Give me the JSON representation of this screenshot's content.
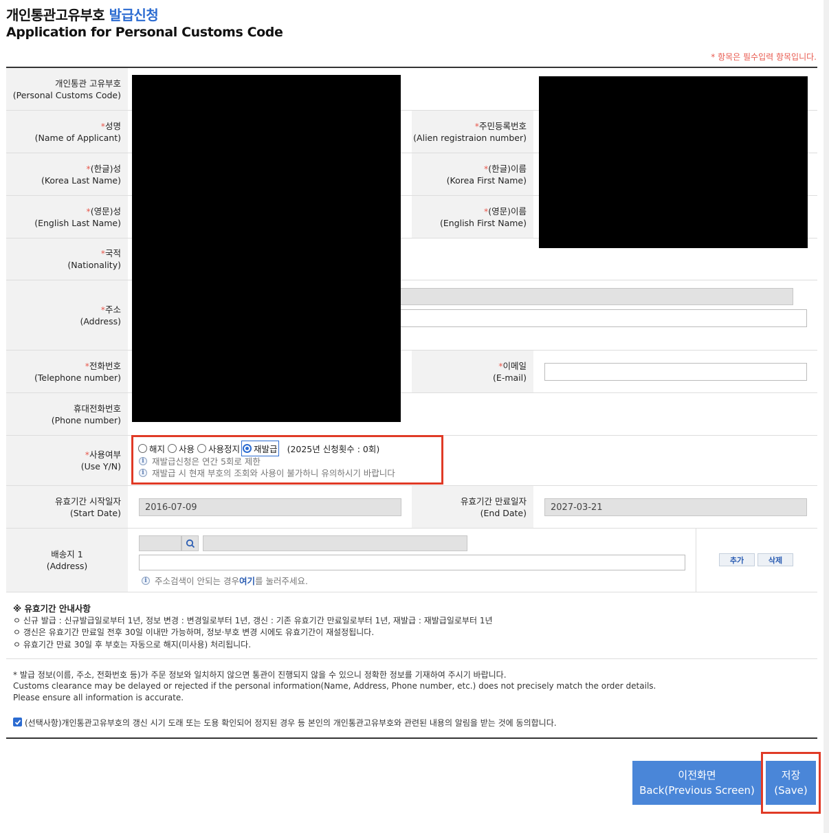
{
  "header": {
    "title_ko_main": "개인통관고유부호",
    "title_ko_accent": "발급신청",
    "title_en": "Application for Personal Customs Code",
    "required_note": "* 항목은 필수입력 항목입니다."
  },
  "form": {
    "customs_code": {
      "label_ko": "개인통관 고유부호",
      "label_en": "(Personal Customs Code)"
    },
    "applicant_name": {
      "label_ko": "성명",
      "label_en": "(Name of Applicant)"
    },
    "alien_reg": {
      "label_ko": "주민등록번호",
      "label_en": "(Alien registraion number)"
    },
    "ko_last": {
      "label_ko": "(한글)성",
      "label_en": "(Korea Last Name)"
    },
    "ko_first": {
      "label_ko": "(한글)이름",
      "label_en": "(Korea First Name)"
    },
    "en_last": {
      "label_ko": "(영문)성",
      "label_en": "(English Last Name)"
    },
    "en_first": {
      "label_ko": "(영문)이름",
      "label_en": "(English First Name)"
    },
    "nationality": {
      "label_ko": "국적",
      "label_en": "(Nationality)"
    },
    "address": {
      "label_ko": "주소",
      "label_en": "(Address)"
    },
    "telephone": {
      "label_ko": "전화번호",
      "label_en": "(Telephone number)"
    },
    "email": {
      "label_ko": "이메일",
      "label_en": "(E-mail)",
      "value": ""
    },
    "phone": {
      "label_ko": "휴대전화번호",
      "label_en": "(Phone number)"
    },
    "use_yn": {
      "label_ko": "사용여부",
      "label_en": "(Use Y/N)",
      "options": [
        "해지",
        "사용",
        "사용정지",
        "재발급"
      ],
      "selected": "재발급",
      "count_text": "(2025년 신청횟수 : 0회)",
      "info1": "재발급신청은 연간 5회로 제한",
      "info2": "재발급 시 현재 부호의 조회와 사용이 불가하니 유의하시기 바랍니다"
    },
    "start_date": {
      "label_ko": "유효기간 시작일자",
      "label_en": "(Start Date)",
      "value": "2016-07-09"
    },
    "end_date": {
      "label_ko": "유효기간 만료일자",
      "label_en": "(End Date)",
      "value": "2027-03-21"
    },
    "delivery": {
      "label_ko": "배송지 1",
      "label_en": "(Address)",
      "hint_prefix": "주소검색이 안되는 경우 ",
      "hint_link": "여기",
      "hint_suffix": "를 눌러주세요.",
      "add_label": "추가",
      "delete_label": "삭제"
    }
  },
  "notes": {
    "title": "※ 유효기간 안내사항",
    "lines": [
      "ㅇ 신규 발급 : 신규발급일로부터 1년, 정보 변경 : 변경일로부터 1년, 갱신 : 기존 유효기간 만료일로부터 1년, 재발급 : 재발급일로부터 1년",
      "ㅇ 갱신은 유효기간 만료일 전후 30일 이내만 가능하며, 정보·부호 변경 시에도 유효기간이 재설정됩니다.",
      "ㅇ 유효기간 만료 30일 후 부호는 자동으로 해지(미사용) 처리됩니다."
    ]
  },
  "disclaimer": {
    "line1": "* 발급 정보(이름, 주소, 전화번호 등)가 주문 정보와 일치하지 않으면 통관이 진행되지 않을 수 있으니 정확한 정보를 기재하여 주시기 바랍니다.",
    "line2": "Customs clearance may be delayed or rejected if the personal information(Name, Address, Phone number, etc.) does not precisely match the order details.",
    "line3": "Please ensure all information is accurate."
  },
  "consent": {
    "checked": true,
    "label": "(선택사항)개인통관고유부호의 갱신 시기 도래 또는 도용 확인되어 정지된 경우 등 본인의 개인통관고유부호와 관련된 내용의 알림을 받는 것에 동의합니다."
  },
  "buttons": {
    "back_ko": "이전화면",
    "back_en": "Back(Previous Screen)",
    "save_ko": "저장",
    "save_en": "(Save)"
  },
  "colors": {
    "accent": "#2b6bd1",
    "required": "#e85a4f",
    "highlight": "#e03a26",
    "button": "#4a86d8"
  }
}
